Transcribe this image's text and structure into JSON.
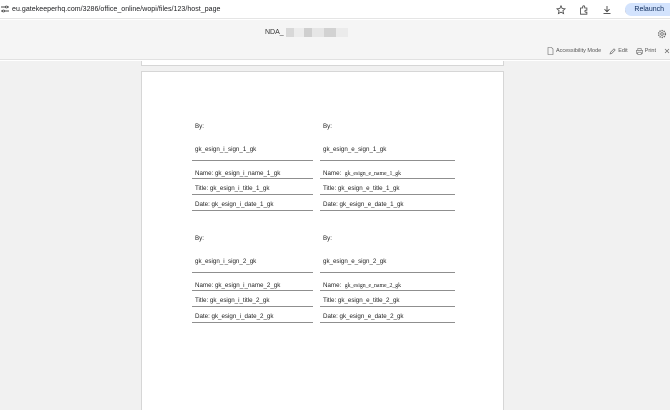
{
  "browser": {
    "url": "eu.gatekeeperhq.com/3286/office_online/wopi/files/123/host_page",
    "relaunch_label": "Relaunch",
    "icons": [
      "tune-icon",
      "star-icon",
      "extensions-icon",
      "download-icon",
      "avatar"
    ]
  },
  "office": {
    "doc_title_prefix": "NDA_",
    "toolbar": {
      "accessibility_label": "Accessibility Mode",
      "edit_label": "Edit",
      "print_label": "Print"
    }
  },
  "document": {
    "blocks": [
      {
        "internal": {
          "by": "By:",
          "sign": "gk_esign_i_sign_1_gk",
          "name": "Name:  gk_esign_i_name_1_gk",
          "title": "Title:  gk_esign_i_title_1_gk",
          "date": "Date:  gk_esign_i_date_1_gk"
        },
        "external": {
          "by": "By:",
          "sign": "gk_esign_e_sign_1_gk",
          "name_label": "Name:",
          "name_value": "gk_esign_e_name_1_gk",
          "title": "Title:  gk_esign_e_title_1_gk",
          "date": "Date: gk_esign_e_date_1_gk"
        }
      },
      {
        "internal": {
          "by": "By:",
          "sign": "gk_esign_i_sign_2_gk",
          "name": "Name:  gk_esign_i_name_2_gk",
          "title": "Title:  gk_esign_i_title_2_gk",
          "date": "Date:  gk_esign_i_date_2_gk"
        },
        "external": {
          "by": "By:",
          "sign": "gk_esign_e_sign_2_gk",
          "name_label": "Name:",
          "name_value": "gk_esign_e_name_2_gk",
          "title": "Title:  gk_esign_e_title_2_gk",
          "date": "Date: gk_esign_e_date_2_gk"
        }
      }
    ]
  }
}
